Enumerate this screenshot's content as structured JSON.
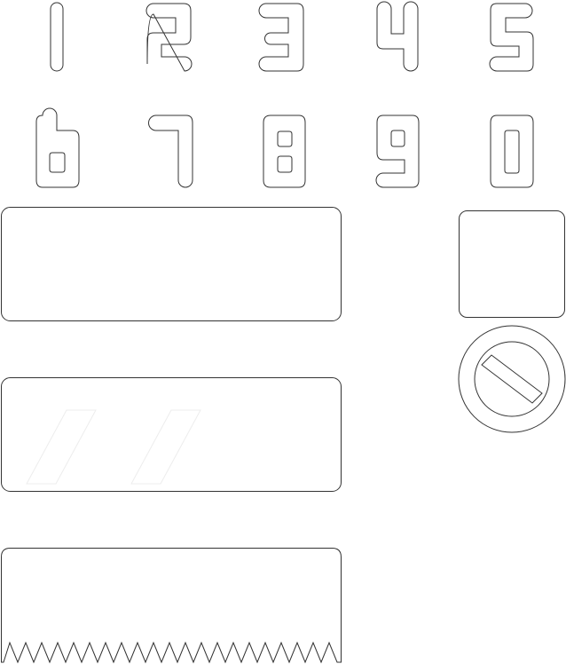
{
  "colors": {
    "outline": "#333333",
    "background": "#ffffff",
    "glare": "#ededed"
  },
  "digits": [
    "1",
    "2",
    "3",
    "4",
    "5",
    "6",
    "7",
    "8",
    "9",
    "0"
  ],
  "plates": [
    {
      "kind": "plain"
    },
    {
      "kind": "glossy"
    },
    {
      "kind": "serrated-bottom"
    }
  ],
  "icons": [
    "square-tile-icon",
    "prohibition-sign-icon"
  ]
}
